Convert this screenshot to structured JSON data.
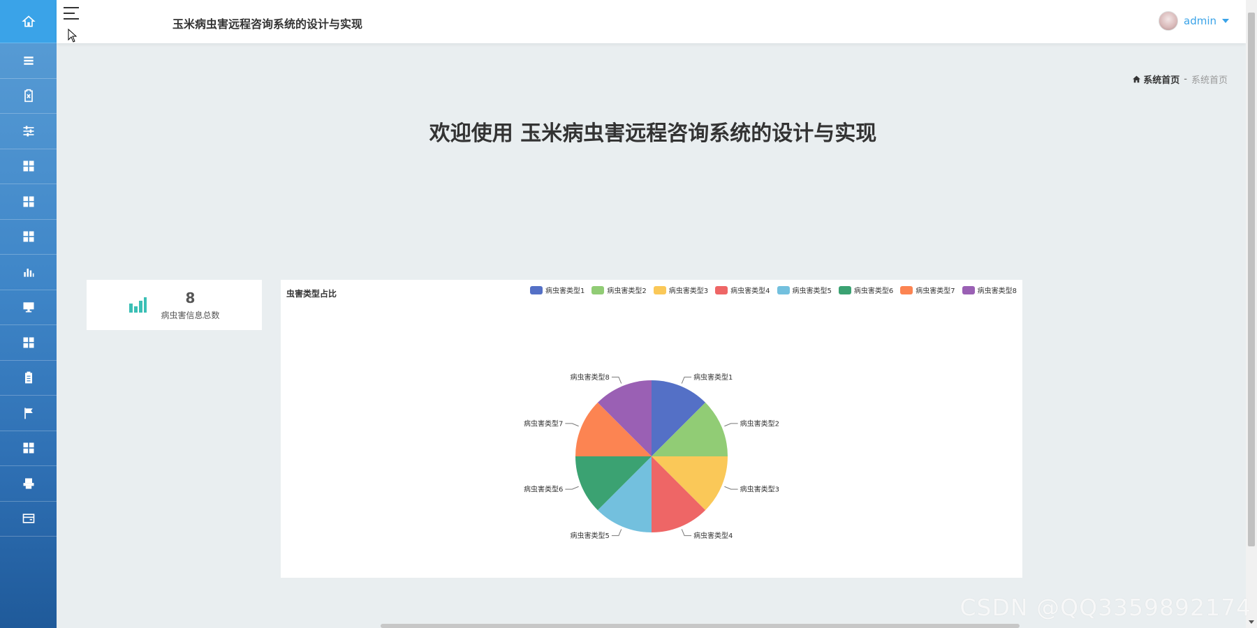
{
  "app": {
    "title": "玉米病虫害远程咨询系统的设计与实现"
  },
  "sidebar": {
    "items": [
      {
        "icon": "home-icon"
      },
      {
        "icon": "list-icon"
      },
      {
        "icon": "clipboard-x-icon"
      },
      {
        "icon": "sliders-icon"
      },
      {
        "icon": "grid-icon"
      },
      {
        "icon": "grid-icon"
      },
      {
        "icon": "grid-icon"
      },
      {
        "icon": "bar-chart-icon"
      },
      {
        "icon": "monitor-icon"
      },
      {
        "icon": "grid-icon"
      },
      {
        "icon": "clipboard-icon"
      },
      {
        "icon": "flag-icon"
      },
      {
        "icon": "grid-icon"
      },
      {
        "icon": "printer-icon"
      },
      {
        "icon": "wallet-icon"
      }
    ]
  },
  "header": {
    "user": "admin"
  },
  "breadcrumb": {
    "home": "系统首页",
    "separator": "-",
    "current": "系统首页"
  },
  "welcome": "欢迎使用 玉米病虫害远程咨询系统的设计与实现",
  "stat": {
    "value": "8",
    "label": "病虫害信息总数",
    "icon": "bar-chart-icon",
    "color": "#3bbfb5"
  },
  "chart_data": {
    "type": "pie",
    "title": "虫害类型占比",
    "legend_position": "top-right",
    "labels": [
      "病虫害类型1",
      "病虫害类型2",
      "病虫害类型3",
      "病虫害类型4",
      "病虫害类型5",
      "病虫害类型6",
      "病虫害类型7",
      "病虫害类型8"
    ],
    "values": [
      1,
      1,
      1,
      1,
      1,
      1,
      1,
      1
    ],
    "colors": [
      "#5470c6",
      "#91cc75",
      "#fac858",
      "#ee6666",
      "#73c0de",
      "#3ba272",
      "#fc8452",
      "#9a60b4"
    ]
  },
  "watermark": "CSDN @QQ3359892174"
}
